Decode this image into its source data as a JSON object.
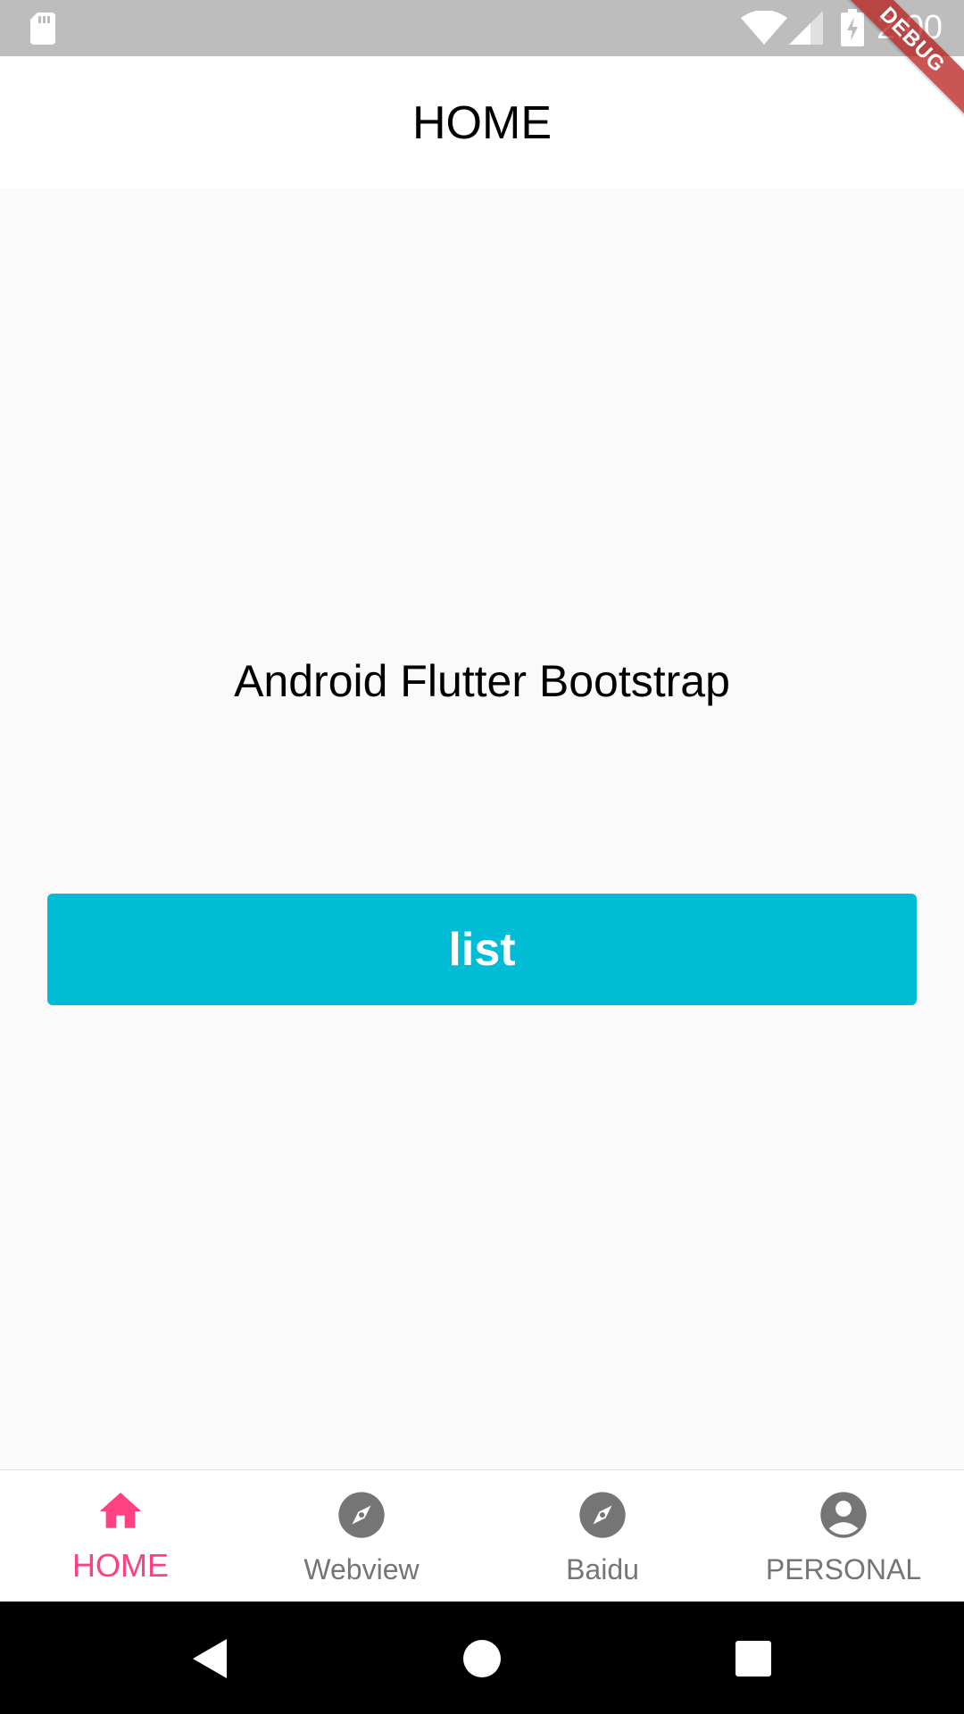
{
  "status_bar": {
    "time": "2:00",
    "icons": [
      "sd-card-icon",
      "wifi-icon",
      "signal-icon",
      "battery-charging-icon"
    ]
  },
  "debug_banner": {
    "label": "DEBUG"
  },
  "app_bar": {
    "title": "HOME"
  },
  "main": {
    "heading": "Android Flutter Bootstrap",
    "list_button_label": "list"
  },
  "bottom_nav": {
    "items": [
      {
        "label": "HOME",
        "icon": "home-icon",
        "active": true
      },
      {
        "label": "Webview",
        "icon": "compass-icon",
        "active": false
      },
      {
        "label": "Baidu",
        "icon": "compass-icon",
        "active": false
      },
      {
        "label": "PERSONAL",
        "icon": "account-circle-icon",
        "active": false
      }
    ]
  },
  "system_nav": {
    "buttons": [
      "back-icon",
      "home-circle-icon",
      "recents-icon"
    ]
  },
  "colors": {
    "status_bar": "#bdbdbd",
    "accent": "#ff4081",
    "button": "#00bcd4",
    "inactive_nav": "#757575",
    "debug_ribbon": "#b71c1c"
  }
}
